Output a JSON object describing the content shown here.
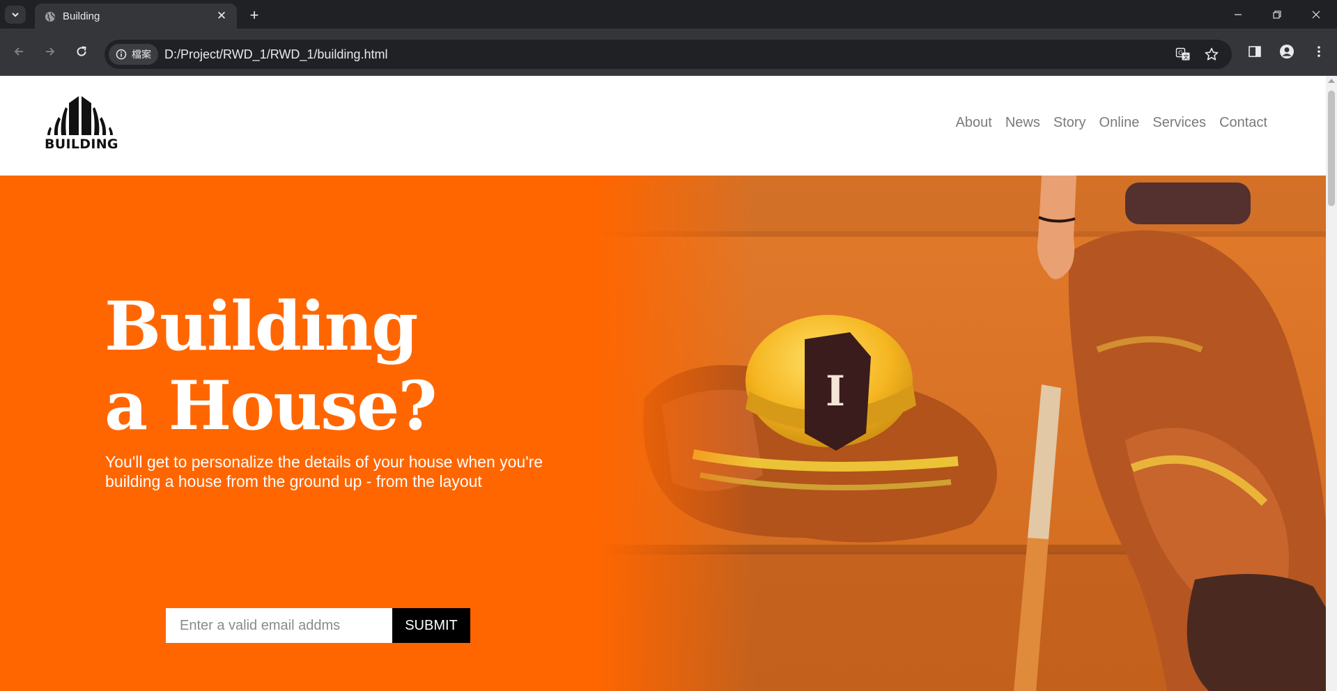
{
  "browser": {
    "tab_title": "Building",
    "site_chip_label": "檔案",
    "url": "D:/Project/RWD_1/RWD_1/building.html"
  },
  "site": {
    "logo_text": "BUILDING",
    "nav": [
      "About",
      "News",
      "Story",
      "Online",
      "Services",
      "Contact"
    ]
  },
  "hero": {
    "title_line1": "Building",
    "title_line2": "a House?",
    "subtitle": "You'll get to personalize the details of your house when you're building a house from the ground up - from the layout",
    "email_placeholder": "Enter a valid email addms",
    "submit_label": "SUBMIT"
  },
  "colors": {
    "accent": "#ff6600",
    "chrome_dark": "#202124",
    "chrome_mid": "#35363a"
  }
}
